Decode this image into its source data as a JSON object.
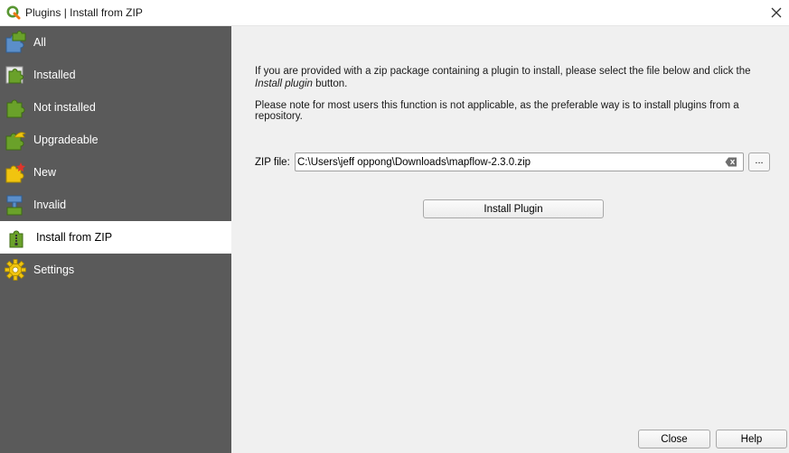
{
  "window": {
    "title": "Plugins | Install from ZIP",
    "icon": "qgis-icon"
  },
  "sidebar": {
    "items": [
      {
        "label": "All",
        "icon": "puzzle-all-icon",
        "active": false
      },
      {
        "label": "Installed",
        "icon": "puzzle-installed-icon",
        "active": false
      },
      {
        "label": "Not installed",
        "icon": "puzzle-not-installed-icon",
        "active": false
      },
      {
        "label": "Upgradeable",
        "icon": "puzzle-upgradeable-icon",
        "active": false
      },
      {
        "label": "New",
        "icon": "puzzle-new-icon",
        "active": false
      },
      {
        "label": "Invalid",
        "icon": "puzzle-invalid-icon",
        "active": false
      },
      {
        "label": "Install from ZIP",
        "icon": "zip-install-icon",
        "active": true
      },
      {
        "label": "Settings",
        "icon": "gear-icon",
        "active": false
      }
    ]
  },
  "main": {
    "intro_before": "If you are provided with a zip package containing a plugin to install, please select the file below and click the ",
    "intro_italic": "Install plugin",
    "intro_after": " button.",
    "note": "Please note for most users this function is not applicable, as the preferable way is to install plugins from a repository.",
    "zip_label": "ZIP file:",
    "zip_value": "C:\\Users\\jeff oppong\\Downloads\\mapflow-2.3.0.zip",
    "browse_label": "...",
    "install_button": "Install Plugin"
  },
  "footer": {
    "close_label": "Close",
    "help_label": "Help"
  },
  "colors": {
    "sidebar_bg": "#5a5a5a",
    "puzzle_green": "#6aa12a",
    "puzzle_blue": "#5b8ec9",
    "star_red": "#e0352b",
    "gear_yellow": "#f1c40f"
  }
}
